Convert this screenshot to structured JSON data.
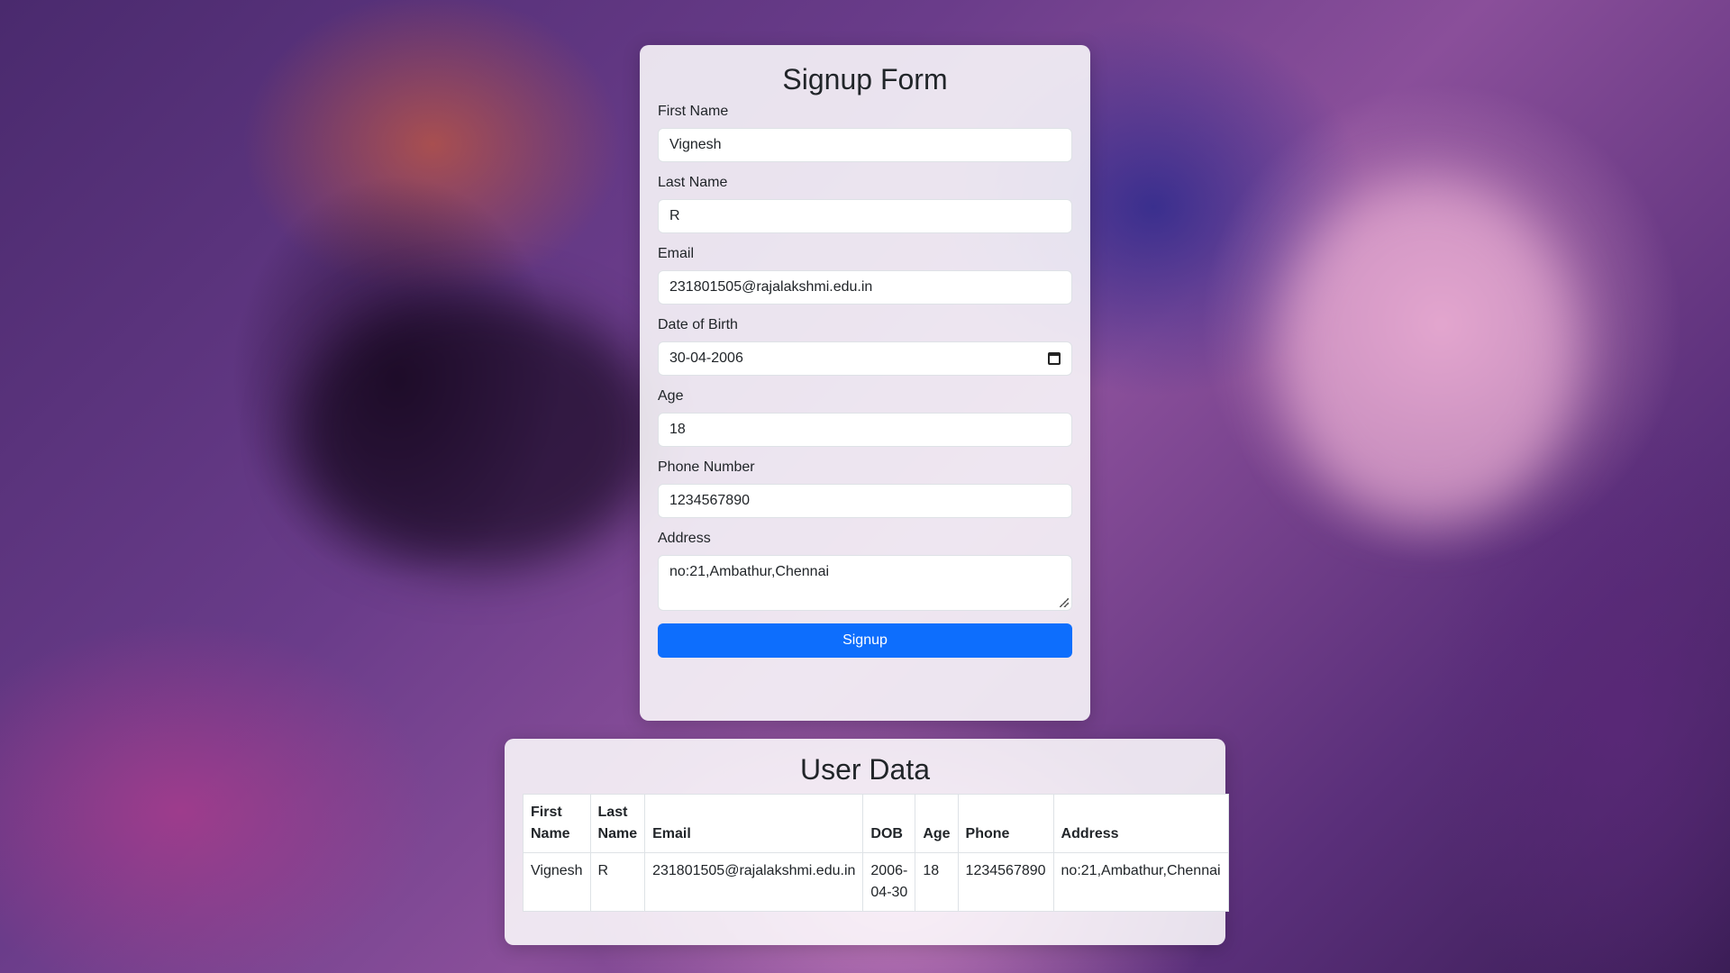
{
  "signup": {
    "title": "Signup Form",
    "fields": [
      {
        "label": "First Name",
        "value": "Vignesh"
      },
      {
        "label": "Last Name",
        "value": "R"
      },
      {
        "label": "Email",
        "value": "231801505@rajalakshmi.edu.in"
      },
      {
        "label": "Date of Birth",
        "value": "30-04-2006"
      },
      {
        "label": "Age",
        "value": "18"
      },
      {
        "label": "Phone Number",
        "value": "1234567890"
      },
      {
        "label": "Address",
        "value": "no:21,Ambathur,Chennai"
      }
    ],
    "submit_label": "Signup"
  },
  "user_data": {
    "title": "User Data",
    "headers": [
      "First Name",
      "Last Name",
      "Email",
      "DOB",
      "Age",
      "Phone",
      "Address"
    ],
    "rows": [
      [
        "Vignesh",
        "R",
        "231801505@rajalakshmi.edu.in",
        "2006-04-30",
        "18",
        "1234567890",
        "no:21,Ambathur,Chennai"
      ]
    ]
  },
  "colors": {
    "primary_button": "#0d6efd",
    "card_background": "#ffffff"
  }
}
